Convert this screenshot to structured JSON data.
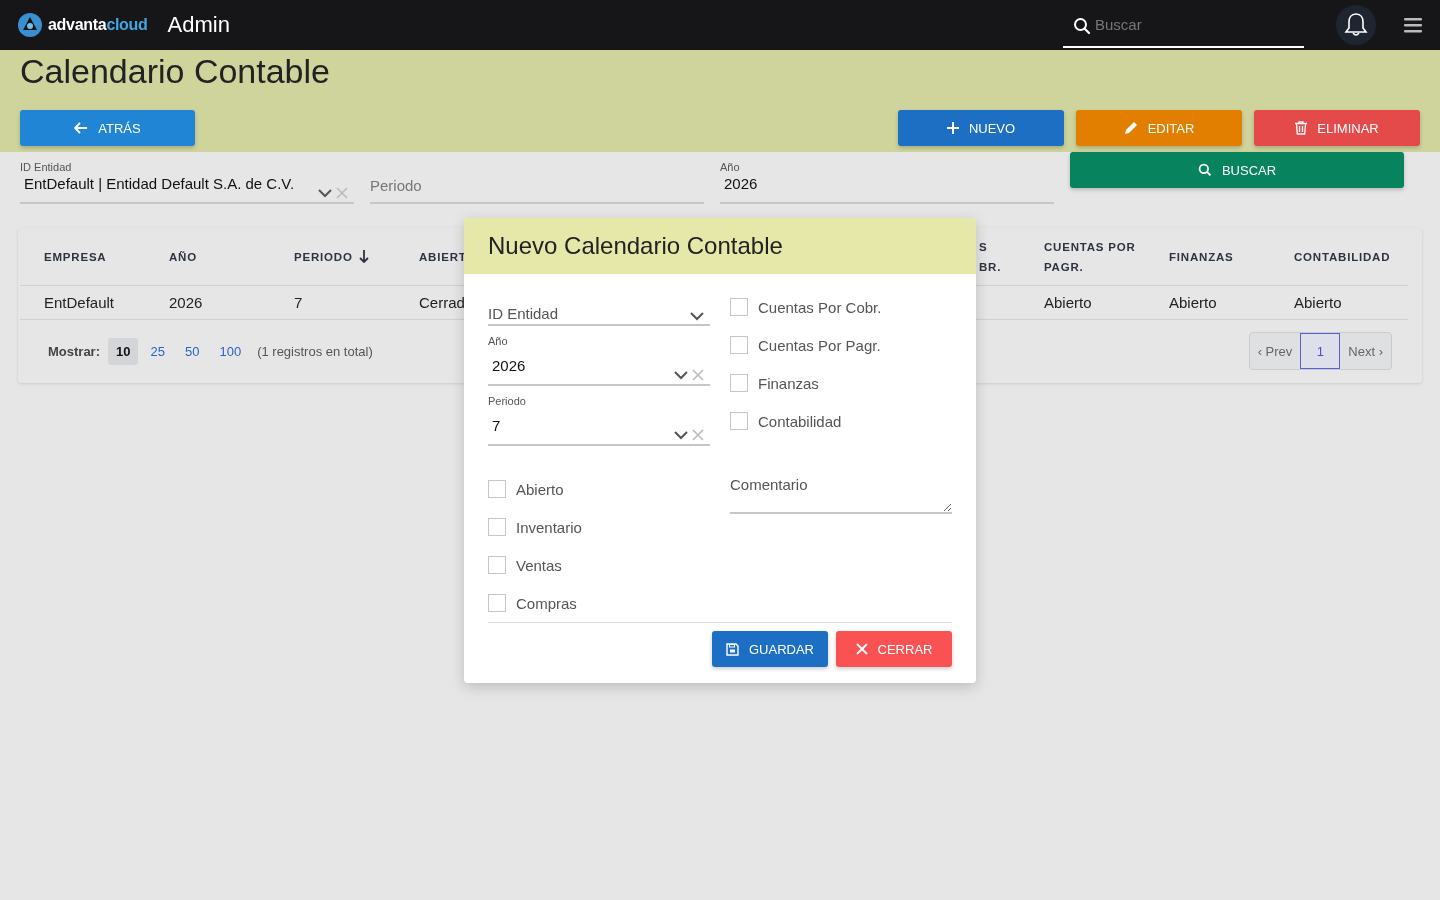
{
  "header": {
    "brand": [
      "advanta",
      "cloud"
    ],
    "title": "Admin",
    "search": {
      "placeholder": "Buscar"
    }
  },
  "page": {
    "title": "Calendario Contable",
    "buttons": [
      {
        "label": "ATRÁS",
        "kind": "back"
      },
      {
        "label": "NUEVO",
        "kind": "new"
      },
      {
        "label": "EDITAR",
        "kind": "edit"
      },
      {
        "label": "ELIMINAR",
        "kind": "delete"
      }
    ]
  },
  "filters": [
    {
      "label": "ID Entidad",
      "value": "EntDefault | Entidad Default S.A. de C.V.",
      "kind": "select"
    },
    {
      "placeholder": "Periodo",
      "kind": "text"
    },
    {
      "label": "Año",
      "value": "2026",
      "kind": "text"
    }
  ],
  "search_button": "BUSCAR",
  "table": {
    "columns": [
      {
        "label": "EMPRESA",
        "sorted": false
      },
      {
        "label": "AÑO",
        "sorted": false
      },
      {
        "label": "PERIODO",
        "sorted": true
      },
      {
        "label": "ABIERT",
        "sorted": false
      },
      {
        "label": "S BR.",
        "sorted": false,
        "kind": "partial"
      },
      {
        "label": "CUENTAS POR PAGR.",
        "sorted": false
      },
      {
        "label": "FINANZAS",
        "sorted": false
      },
      {
        "label": "CONTABILIDAD",
        "sorted": false
      }
    ],
    "rows": [
      {
        "cells": [
          "EntDefault",
          "2026",
          "7",
          "Cerrad",
          "",
          "Abierto",
          "Abierto",
          "Abierto"
        ]
      }
    ]
  },
  "pagination": {
    "show_label": "Mostrar:",
    "sizes": [
      {
        "label": "10",
        "selected": true
      },
      {
        "label": "25",
        "selected": false
      },
      {
        "label": "50",
        "selected": false
      },
      {
        "label": "100",
        "selected": false
      }
    ],
    "total": "(1 registros en total)",
    "prev": "‹ Prev",
    "pages": [
      {
        "label": "1",
        "selected": true
      }
    ],
    "next": "Next ›"
  },
  "modal": {
    "title": "Nuevo Calendario Contable",
    "fields": [
      {
        "placeholder": "ID Entidad",
        "clearable": false
      },
      {
        "label": "Año",
        "value": "2026",
        "clearable": true
      },
      {
        "label": "Periodo",
        "value": "7",
        "clearable": true
      }
    ],
    "left_checks": [
      {
        "label": "Abierto",
        "checked": false
      },
      {
        "label": "Inventario",
        "checked": false
      },
      {
        "label": "Ventas",
        "checked": false
      },
      {
        "label": "Compras",
        "checked": false
      }
    ],
    "right_checks": [
      {
        "label": "Cuentas Por Cobr.",
        "checked": false
      },
      {
        "label": "Cuentas Por Pagr.",
        "checked": false
      },
      {
        "label": "Finanzas",
        "checked": false
      },
      {
        "label": "Contabilidad",
        "checked": false
      }
    ],
    "comment": {
      "placeholder": "Comentario"
    },
    "buttons": [
      {
        "label": "GUARDAR",
        "kind": "save"
      },
      {
        "label": "CERRAR",
        "kind": "close"
      }
    ]
  }
}
